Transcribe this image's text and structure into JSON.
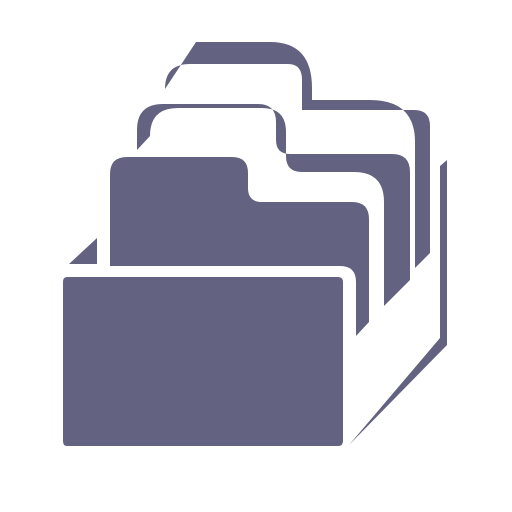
{
  "icon": {
    "name": "stacked-folders-icon",
    "fill_color": "#636381",
    "background_color": "#ffffff",
    "folder_count": 3
  }
}
